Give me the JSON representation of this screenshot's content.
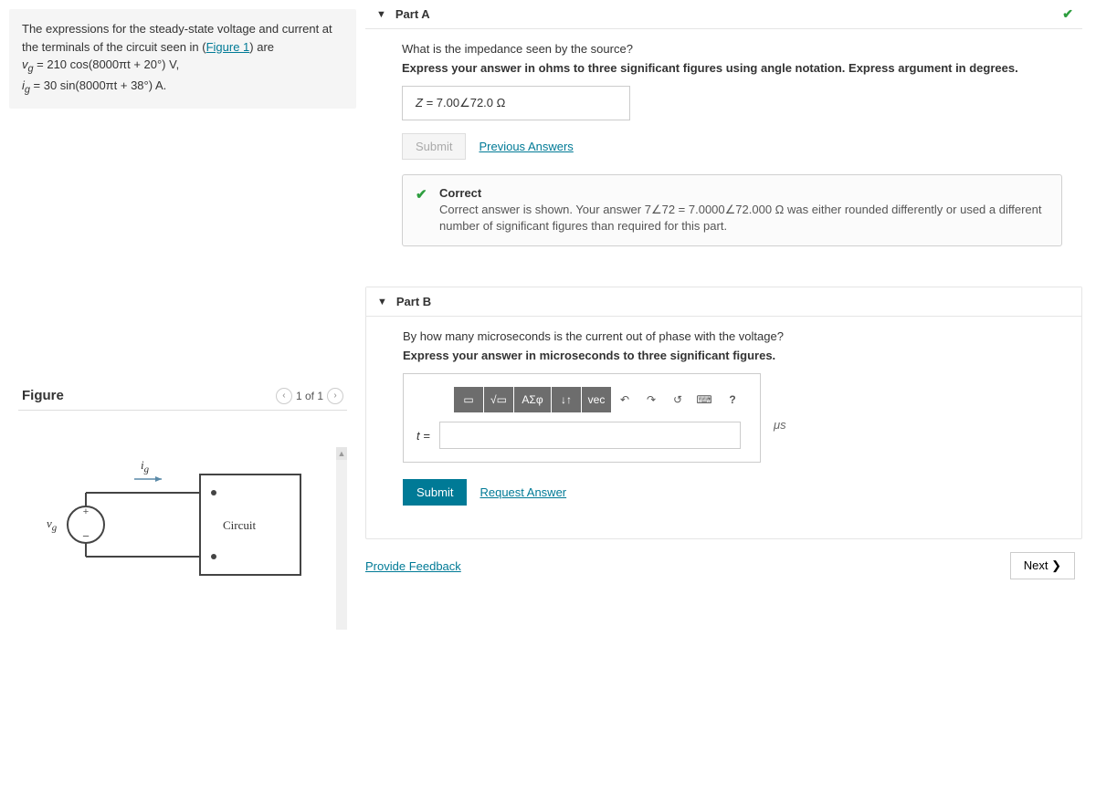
{
  "problem": {
    "intro_pre": "The expressions for the steady-state voltage and current at the terminals of the circuit seen in (",
    "figure_link": "Figure 1",
    "intro_post": ") are",
    "eq1_lhs": "v",
    "eq1_sub": "g",
    "eq1_rhs": " = 210 cos(8000πt + 20°) V,",
    "eq2_lhs": "i",
    "eq2_sub": "g",
    "eq2_rhs": " = 30 sin(8000πt + 38°) A."
  },
  "partA": {
    "title": "Part A",
    "question": "What is the impedance seen by the source?",
    "instruction": "Express your answer in ohms to three significant figures using angle notation. Express argument in degrees.",
    "answer_label": "Z = ",
    "answer_value": "7.00∠72.0  Ω",
    "submit": "Submit",
    "prev_answers": "Previous Answers",
    "correct_title": "Correct",
    "correct_msg": "Correct answer is shown. Your answer 7∠72 = 7.0000∠72.000 Ω was either rounded differently or used a different number of significant figures than required for this part."
  },
  "partB": {
    "title": "Part B",
    "question": "By how many microseconds is the current out of phase with the voltage?",
    "instruction": "Express your answer in microseconds to three significant figures.",
    "toolbar": {
      "templates": "▭",
      "root": "√▭",
      "greek": "ΑΣφ",
      "subsup": "↓↑",
      "vec": "vec",
      "undo": "↶",
      "redo": "↷",
      "reset": "↺",
      "keyboard": "⌨",
      "help": "?"
    },
    "input_label": "t = ",
    "unit": "μs",
    "submit": "Submit",
    "request_answer": "Request Answer"
  },
  "footer": {
    "provide_feedback": "Provide Feedback",
    "next": "Next ❯"
  },
  "figure": {
    "title": "Figure",
    "pager": "1 of 1",
    "vg_label": "v",
    "vg_sub": "g",
    "ig_label": "i",
    "ig_sub": "g",
    "circuit_label": "Circuit"
  }
}
